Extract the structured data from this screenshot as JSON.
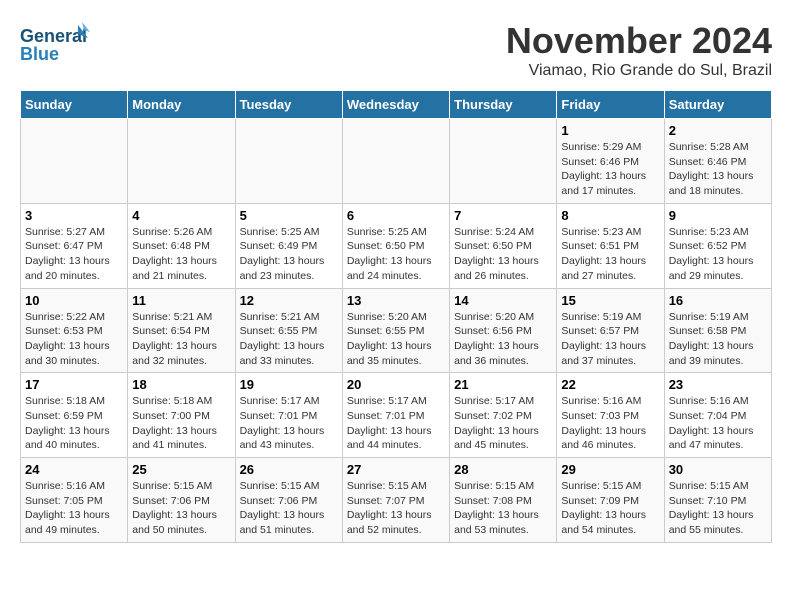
{
  "logo": {
    "line1": "General",
    "line2": "Blue"
  },
  "title": "November 2024",
  "subtitle": "Viamao, Rio Grande do Sul, Brazil",
  "weekdays": [
    "Sunday",
    "Monday",
    "Tuesday",
    "Wednesday",
    "Thursday",
    "Friday",
    "Saturday"
  ],
  "weeks": [
    [
      {
        "day": "",
        "info": ""
      },
      {
        "day": "",
        "info": ""
      },
      {
        "day": "",
        "info": ""
      },
      {
        "day": "",
        "info": ""
      },
      {
        "day": "",
        "info": ""
      },
      {
        "day": "1",
        "info": "Sunrise: 5:29 AM\nSunset: 6:46 PM\nDaylight: 13 hours\nand 17 minutes."
      },
      {
        "day": "2",
        "info": "Sunrise: 5:28 AM\nSunset: 6:46 PM\nDaylight: 13 hours\nand 18 minutes."
      }
    ],
    [
      {
        "day": "3",
        "info": "Sunrise: 5:27 AM\nSunset: 6:47 PM\nDaylight: 13 hours\nand 20 minutes."
      },
      {
        "day": "4",
        "info": "Sunrise: 5:26 AM\nSunset: 6:48 PM\nDaylight: 13 hours\nand 21 minutes."
      },
      {
        "day": "5",
        "info": "Sunrise: 5:25 AM\nSunset: 6:49 PM\nDaylight: 13 hours\nand 23 minutes."
      },
      {
        "day": "6",
        "info": "Sunrise: 5:25 AM\nSunset: 6:50 PM\nDaylight: 13 hours\nand 24 minutes."
      },
      {
        "day": "7",
        "info": "Sunrise: 5:24 AM\nSunset: 6:50 PM\nDaylight: 13 hours\nand 26 minutes."
      },
      {
        "day": "8",
        "info": "Sunrise: 5:23 AM\nSunset: 6:51 PM\nDaylight: 13 hours\nand 27 minutes."
      },
      {
        "day": "9",
        "info": "Sunrise: 5:23 AM\nSunset: 6:52 PM\nDaylight: 13 hours\nand 29 minutes."
      }
    ],
    [
      {
        "day": "10",
        "info": "Sunrise: 5:22 AM\nSunset: 6:53 PM\nDaylight: 13 hours\nand 30 minutes."
      },
      {
        "day": "11",
        "info": "Sunrise: 5:21 AM\nSunset: 6:54 PM\nDaylight: 13 hours\nand 32 minutes."
      },
      {
        "day": "12",
        "info": "Sunrise: 5:21 AM\nSunset: 6:55 PM\nDaylight: 13 hours\nand 33 minutes."
      },
      {
        "day": "13",
        "info": "Sunrise: 5:20 AM\nSunset: 6:55 PM\nDaylight: 13 hours\nand 35 minutes."
      },
      {
        "day": "14",
        "info": "Sunrise: 5:20 AM\nSunset: 6:56 PM\nDaylight: 13 hours\nand 36 minutes."
      },
      {
        "day": "15",
        "info": "Sunrise: 5:19 AM\nSunset: 6:57 PM\nDaylight: 13 hours\nand 37 minutes."
      },
      {
        "day": "16",
        "info": "Sunrise: 5:19 AM\nSunset: 6:58 PM\nDaylight: 13 hours\nand 39 minutes."
      }
    ],
    [
      {
        "day": "17",
        "info": "Sunrise: 5:18 AM\nSunset: 6:59 PM\nDaylight: 13 hours\nand 40 minutes."
      },
      {
        "day": "18",
        "info": "Sunrise: 5:18 AM\nSunset: 7:00 PM\nDaylight: 13 hours\nand 41 minutes."
      },
      {
        "day": "19",
        "info": "Sunrise: 5:17 AM\nSunset: 7:01 PM\nDaylight: 13 hours\nand 43 minutes."
      },
      {
        "day": "20",
        "info": "Sunrise: 5:17 AM\nSunset: 7:01 PM\nDaylight: 13 hours\nand 44 minutes."
      },
      {
        "day": "21",
        "info": "Sunrise: 5:17 AM\nSunset: 7:02 PM\nDaylight: 13 hours\nand 45 minutes."
      },
      {
        "day": "22",
        "info": "Sunrise: 5:16 AM\nSunset: 7:03 PM\nDaylight: 13 hours\nand 46 minutes."
      },
      {
        "day": "23",
        "info": "Sunrise: 5:16 AM\nSunset: 7:04 PM\nDaylight: 13 hours\nand 47 minutes."
      }
    ],
    [
      {
        "day": "24",
        "info": "Sunrise: 5:16 AM\nSunset: 7:05 PM\nDaylight: 13 hours\nand 49 minutes."
      },
      {
        "day": "25",
        "info": "Sunrise: 5:15 AM\nSunset: 7:06 PM\nDaylight: 13 hours\nand 50 minutes."
      },
      {
        "day": "26",
        "info": "Sunrise: 5:15 AM\nSunset: 7:06 PM\nDaylight: 13 hours\nand 51 minutes."
      },
      {
        "day": "27",
        "info": "Sunrise: 5:15 AM\nSunset: 7:07 PM\nDaylight: 13 hours\nand 52 minutes."
      },
      {
        "day": "28",
        "info": "Sunrise: 5:15 AM\nSunset: 7:08 PM\nDaylight: 13 hours\nand 53 minutes."
      },
      {
        "day": "29",
        "info": "Sunrise: 5:15 AM\nSunset: 7:09 PM\nDaylight: 13 hours\nand 54 minutes."
      },
      {
        "day": "30",
        "info": "Sunrise: 5:15 AM\nSunset: 7:10 PM\nDaylight: 13 hours\nand 55 minutes."
      }
    ]
  ]
}
